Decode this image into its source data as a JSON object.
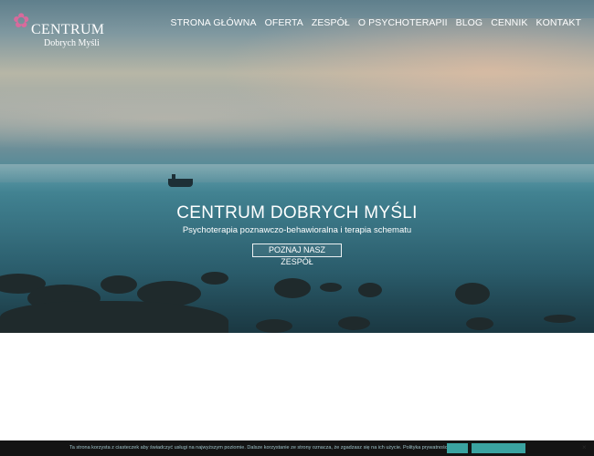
{
  "logo": {
    "title": "CENTRUM",
    "subtitle": "Dobrych Myśli",
    "flower_icon": "flower-icon",
    "flower_color": "#d86a9c"
  },
  "nav": {
    "items": [
      {
        "label": "STRONA GŁÓWNA"
      },
      {
        "label": "OFERTA"
      },
      {
        "label": "ZESPÓŁ"
      },
      {
        "label": "O PSYCHOTERAPII"
      },
      {
        "label": "BLOG"
      },
      {
        "label": "CENNIK"
      },
      {
        "label": "KONTAKT"
      }
    ]
  },
  "hero": {
    "title": "CENTRUM DOBRYCH MYŚLI",
    "subtitle": "Psychoterapia poznawczo-behawioralna i terapia schematu",
    "button_label": "POZNAJ NASZ ZESPÓŁ"
  },
  "cookie_bar": {
    "text": "Ta strona korzysta z ciasteczek aby świadczyć usługi na najwyższym poziomie. Dalsze korzystanie ze strony oznacza, że zgadzasz się na ich użycie.",
    "policy_link": "Polityka prywatności",
    "accent_color": "#3aa3a1",
    "close_icon": "close-icon"
  }
}
